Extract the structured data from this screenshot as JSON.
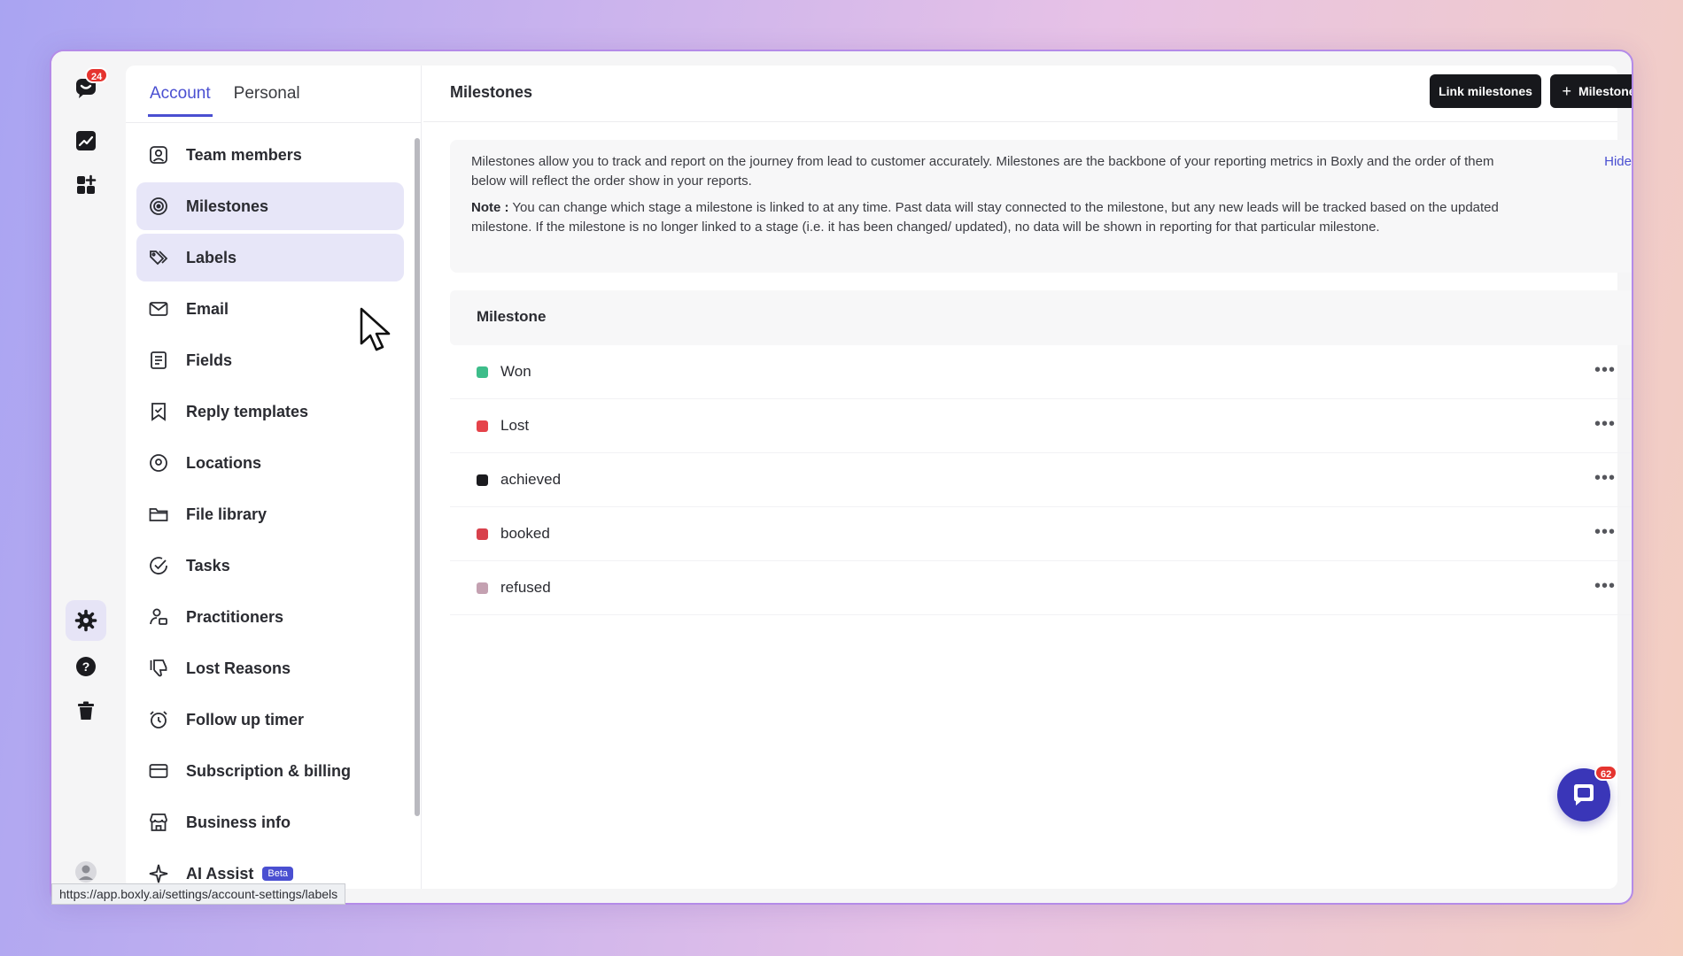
{
  "rail": {
    "notification_count": "24"
  },
  "tabs": [
    {
      "label": "Account"
    },
    {
      "label": "Personal"
    }
  ],
  "nav": [
    {
      "label": "Team members",
      "icon": "user-square-icon"
    },
    {
      "label": "Milestones",
      "icon": "target-icon"
    },
    {
      "label": "Labels",
      "icon": "tag-icon"
    },
    {
      "label": "Email",
      "icon": "mail-icon"
    },
    {
      "label": "Fields",
      "icon": "list-document-icon"
    },
    {
      "label": "Reply templates",
      "icon": "bookmark-check-icon"
    },
    {
      "label": "Locations",
      "icon": "location-pin-icon"
    },
    {
      "label": "File library",
      "icon": "folder-icon"
    },
    {
      "label": "Tasks",
      "icon": "check-circle-icon"
    },
    {
      "label": "Practitioners",
      "icon": "user-badge-icon"
    },
    {
      "label": "Lost Reasons",
      "icon": "thumbs-down-icon"
    },
    {
      "label": "Follow up timer",
      "icon": "alarm-clock-icon"
    },
    {
      "label": "Subscription & billing",
      "icon": "credit-card-icon"
    },
    {
      "label": "Business info",
      "icon": "store-icon"
    },
    {
      "label": "AI Assist",
      "icon": "sparkle-icon",
      "badge": "Beta"
    }
  ],
  "header": {
    "title": "Milestones",
    "link_button": "Link milestones",
    "add_button": "Milestone"
  },
  "info": {
    "text": "Milestones allow you to track and report on the journey from lead to customer accurately. Milestones are the backbone of your reporting metrics in Boxly and the order of them below will reflect the order show in your reports.",
    "note_label": "Note :",
    "note_text": " You can change which stage a milestone is linked to at any time. Past data will stay connected to the milestone, but any new leads will be tracked based on the updated milestone. If the milestone is no longer linked to a stage (i.e. it has been changed/ updated), no data will be shown in reporting for that particular milestone.",
    "hide": "Hide"
  },
  "table": {
    "header": "Milestone",
    "rows": [
      {
        "label": "Won",
        "color": "#3dbd8a"
      },
      {
        "label": "Lost",
        "color": "#e5434a"
      },
      {
        "label": "achieved",
        "color": "#1b1b1f"
      },
      {
        "label": "booked",
        "color": "#d8414c"
      },
      {
        "label": "refused",
        "color": "#c4a1b1"
      }
    ],
    "more": "•••"
  },
  "chat": {
    "badge": "62"
  },
  "status_url": "https://app.boxly.ai/settings/account-settings/labels"
}
